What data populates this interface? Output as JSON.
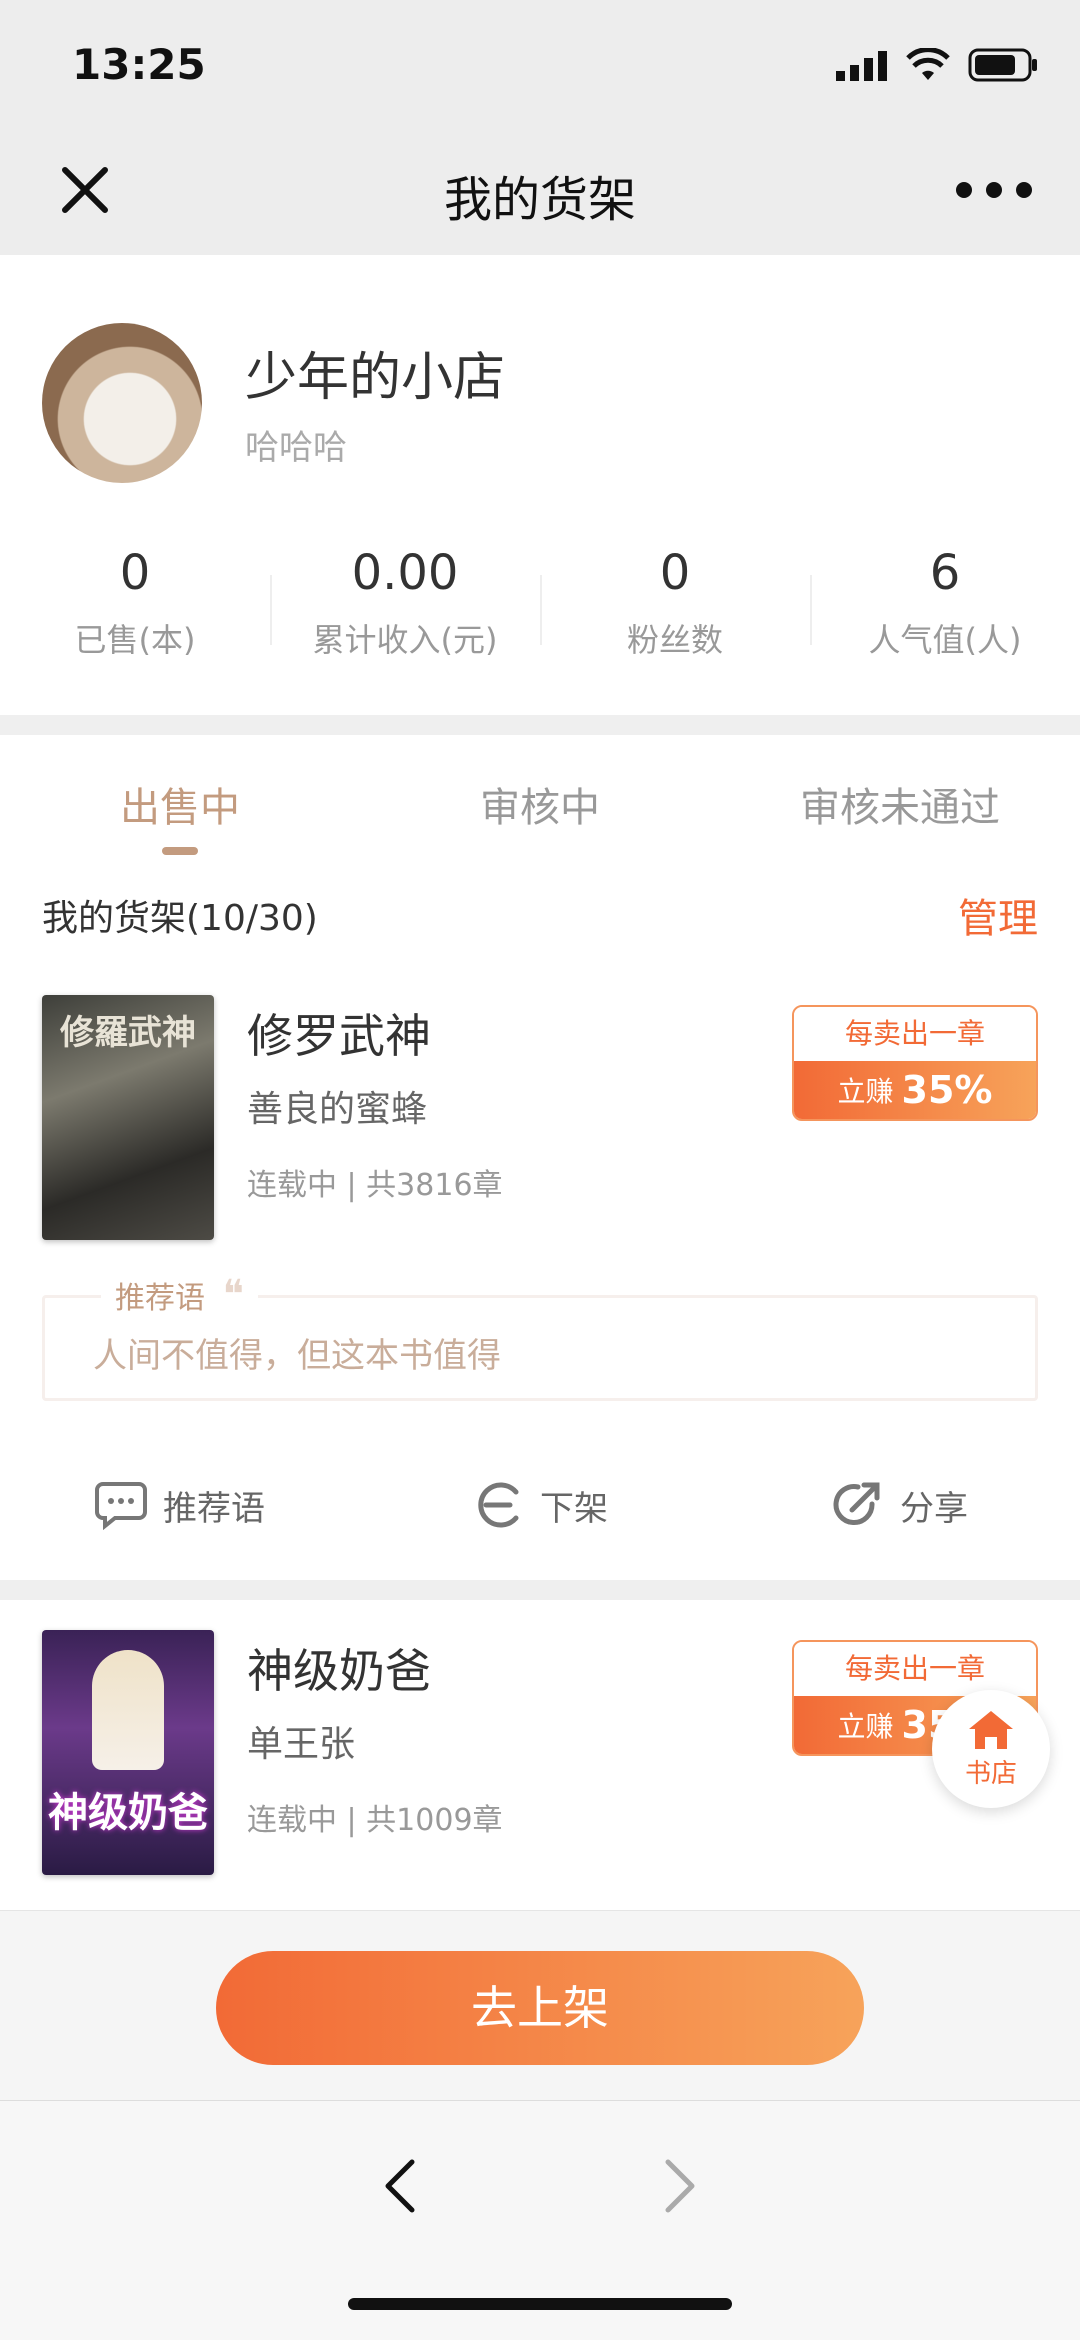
{
  "status": {
    "time": "13:25"
  },
  "nav": {
    "title": "我的货架"
  },
  "profile": {
    "name": "少年的小店",
    "subtitle": "哈哈哈",
    "stats": [
      {
        "value": "0",
        "label": "已售(本)"
      },
      {
        "value": "0.00",
        "label": "累计收入(元)"
      },
      {
        "value": "0",
        "label": "粉丝数"
      },
      {
        "value": "6",
        "label": "人气值(人)"
      }
    ]
  },
  "tabs": [
    "出售中",
    "审核中",
    "审核未通过"
  ],
  "shelf": {
    "title": "我的货架(10/30)",
    "manage": "管理"
  },
  "books": [
    {
      "title": "修罗武神",
      "author": "善良的蜜蜂",
      "meta": "连载中 | 共3816章",
      "cover_text": "修羅武神",
      "earn_top": "每卖出一章",
      "earn_prefix": "立赚",
      "earn_value": "35%"
    },
    {
      "title": "神级奶爸",
      "author": "单王张",
      "meta": "连载中 | 共1009章",
      "cover_text": "神级奶爸",
      "earn_top": "每卖出一章",
      "earn_prefix": "立赚",
      "earn_value": "35%"
    }
  ],
  "recommend": {
    "label": "推荐语",
    "text": "人间不值得，但这本书值得"
  },
  "actions": {
    "recommend": "推荐语",
    "unshelve": "下架",
    "share": "分享"
  },
  "fab": {
    "label": "书店"
  },
  "footer": {
    "button": "去上架"
  },
  "colors": {
    "accent": "#f26a36",
    "tab_active": "#c39b7f"
  }
}
